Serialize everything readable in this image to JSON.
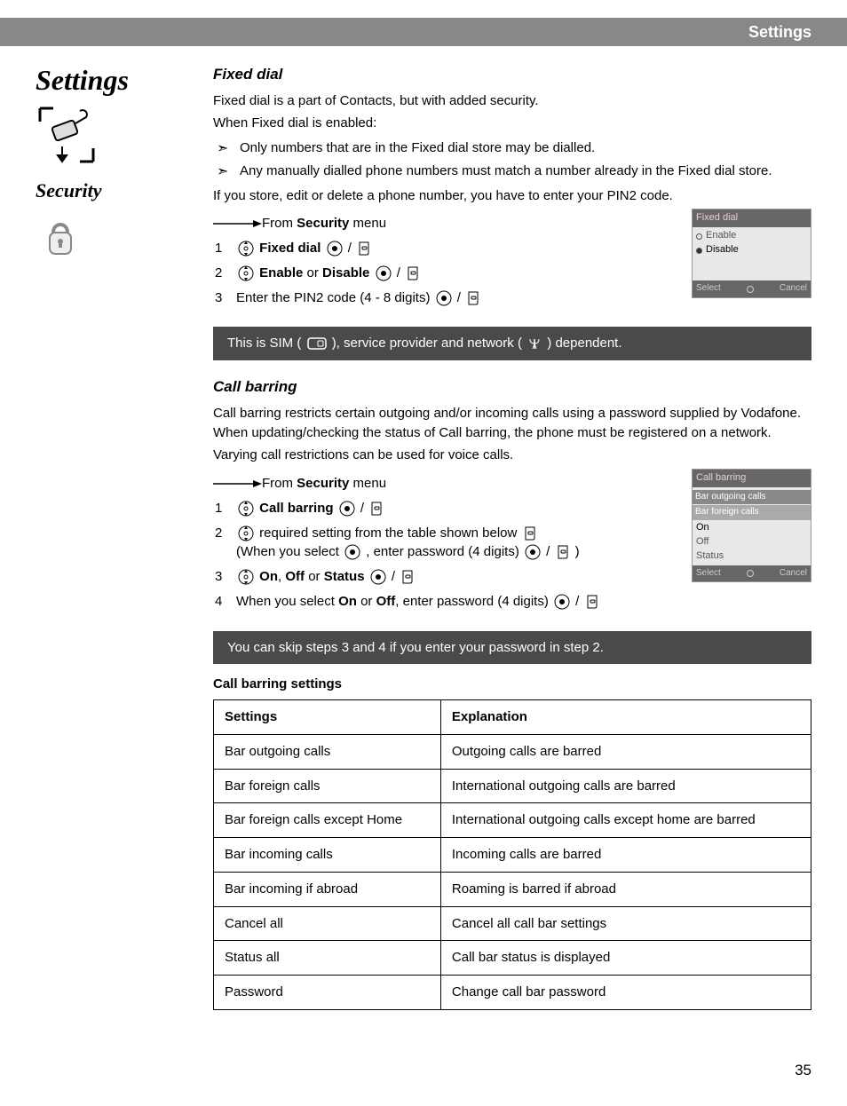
{
  "header": {
    "title": "Settings"
  },
  "sidebar": {
    "title": "Settings",
    "subtitle": "Security"
  },
  "fixed_dial": {
    "heading": "Fixed dial",
    "intro1": "Fixed dial is a part of Contacts, but with added security.",
    "intro2": "When Fixed dial is enabled:",
    "bullets": [
      "Only numbers that are in the Fixed dial store may be dialled.",
      "Any manually dialled phone numbers must match a number already in the Fixed dial store."
    ],
    "pin2_line": "If you store, edit or delete a phone number, you have to enter your PIN2 code.",
    "from_prefix": "From ",
    "from_bold": "Security",
    "from_suffix": " menu",
    "step1_label": "Fixed dial",
    "step2_prefix": "Enable",
    "step2_mid": " or ",
    "step2_suffix": "Disable",
    "step3": "Enter the PIN2 code (4 - 8 digits) ",
    "note_prefix": "This is SIM (",
    "note_mid": "), service provider and network (",
    "note_suffix": ") dependent.",
    "screenshot": {
      "title": "Fixed dial",
      "opt1": "Enable",
      "opt2": "Disable",
      "left": "Select",
      "right": "Cancel"
    }
  },
  "call_barring": {
    "heading": "Call barring",
    "intro": "Call barring restricts certain outgoing and/or incoming calls using a password supplied by Vodafone. When updating/checking the status of Call barring, the phone must be registered on a network.",
    "intro2": "Varying call restrictions can be used for voice calls.",
    "from_prefix": "From ",
    "from_bold": "Security",
    "from_suffix": " menu",
    "step1_label": "Call barring",
    "step2": "required setting from the table shown below ",
    "step2_sub_prefix": "(When you select ",
    "step2_sub_mid": ", enter password (4 digits) ",
    "step2_sub_suffix": ")",
    "step3_on": "On",
    "step3_sep1": ", ",
    "step3_off": "Off",
    "step3_sep2": " or ",
    "step3_status": "Status",
    "step4_prefix": "When you select ",
    "step4_on": "On",
    "step4_mid": " or ",
    "step4_off": "Off",
    "step4_suffix": ", enter password (4 digits) ",
    "note": "You can skip steps 3 and 4 if you enter your password in step 2.",
    "table_title": "Call barring settings",
    "col1": "Settings",
    "col2": "Explanation",
    "rows": [
      {
        "s": "Bar outgoing calls",
        "e": "Outgoing calls are barred"
      },
      {
        "s": "Bar foreign calls",
        "e": "International outgoing calls are barred"
      },
      {
        "s": "Bar foreign calls except Home",
        "e": "International outgoing calls except home are barred"
      },
      {
        "s": "Bar incoming calls",
        "e": "Incoming calls are barred"
      },
      {
        "s": "Bar incoming if abroad",
        "e": "Roaming is barred if abroad"
      },
      {
        "s": "Cancel all",
        "e": "Cancel all call bar settings"
      },
      {
        "s": "Status all",
        "e": "Call bar status is displayed"
      },
      {
        "s": "Password",
        "e": "Change call bar password"
      }
    ],
    "screenshot": {
      "title": "Call barring",
      "sub1": "Bar outgoing calls",
      "sub2": "Bar foreign calls",
      "opt1": "On",
      "opt2": "Off",
      "opt3": "Status",
      "left": "Select",
      "right": "Cancel"
    }
  },
  "page_number": "35"
}
